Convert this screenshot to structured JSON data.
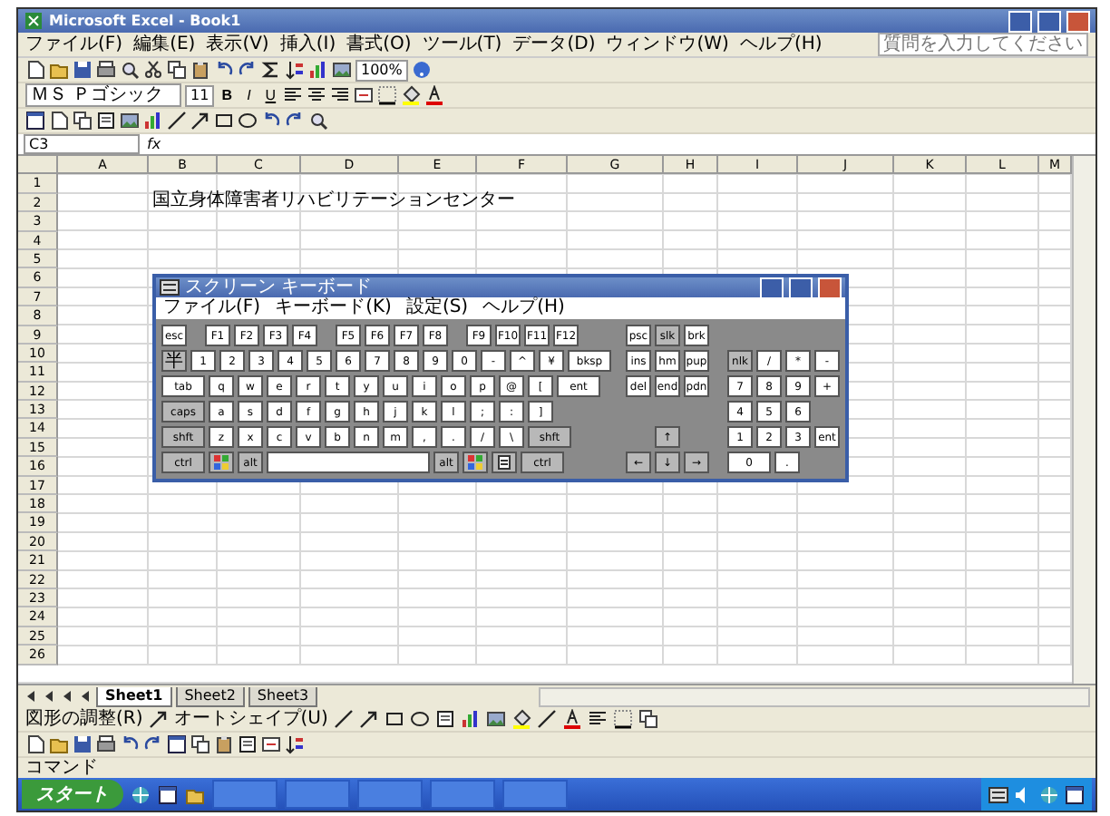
{
  "window": {
    "title": "Microsoft Excel - Book1"
  },
  "menu": {
    "items": [
      "ファイル(F)",
      "編集(E)",
      "表示(V)",
      "挿入(I)",
      "書式(O)",
      "ツール(T)",
      "データ(D)",
      "ウィンドウ(W)",
      "ヘルプ(H)"
    ],
    "help_placeholder": "質問を入力してください"
  },
  "standard_toolbar": {
    "zoom": "100%"
  },
  "formatting_toolbar": {
    "font": "ＭＳ Ｐゴシック",
    "size": "11",
    "bold": "B",
    "italic": "I",
    "underline": "U"
  },
  "formula_bar": {
    "name_box": "C3",
    "fx": "fx"
  },
  "sheet": {
    "columns": [
      "A",
      "B",
      "C",
      "D",
      "E",
      "F",
      "G",
      "H",
      "I",
      "J",
      "K",
      "L",
      "M"
    ],
    "rows": [
      {
        "header": "1"
      },
      {
        "header": "2",
        "cells": [
          null,
          "国立身体障害者リハビリテーションセンター"
        ]
      },
      {
        "header": "3"
      },
      {
        "header": "4"
      },
      {
        "header": "5"
      },
      {
        "header": "6"
      },
      {
        "header": "7"
      },
      {
        "header": "8"
      },
      {
        "header": "9"
      },
      {
        "header": "10"
      },
      {
        "header": "11"
      },
      {
        "header": "12"
      },
      {
        "header": "13"
      },
      {
        "header": "14"
      },
      {
        "header": "15"
      },
      {
        "header": "16"
      },
      {
        "header": "17"
      },
      {
        "header": "18"
      },
      {
        "header": "19"
      },
      {
        "header": "20"
      },
      {
        "header": "21"
      },
      {
        "header": "22"
      },
      {
        "header": "23"
      },
      {
        "header": "24"
      },
      {
        "header": "25"
      },
      {
        "header": "26"
      }
    ]
  },
  "sheet_tabs": [
    {
      "label": "Sheet1",
      "selected": true
    },
    {
      "label": "Sheet2",
      "selected": false
    },
    {
      "label": "Sheet3",
      "selected": false
    }
  ],
  "drawing_toolbar": {
    "adjust": "図形の調整(R)",
    "autoshape": "オートシェイプ(U)"
  },
  "status_bar": {
    "text": "コマンド"
  },
  "taskbar": {
    "start": "スタート"
  },
  "keyboard": {
    "title": "スクリーン キーボード",
    "menu": [
      "ファイル(F)",
      "キーボード(K)",
      "設定(S)",
      "ヘルプ(H)"
    ],
    "rows": [
      {
        "main": [
          {
            "label": "esc",
            "kind": "key"
          },
          {
            "label": "F1",
            "kind": "lead"
          },
          {
            "label": "F2",
            "kind": "key"
          },
          {
            "label": "F3",
            "kind": "key"
          },
          {
            "label": "F4",
            "kind": "key"
          },
          {
            "label": "F5",
            "kind": "lead"
          },
          {
            "label": "F6",
            "kind": "key"
          },
          {
            "label": "F7",
            "kind": "key"
          },
          {
            "label": "F8",
            "kind": "key"
          },
          {
            "label": "F9",
            "kind": "lead"
          },
          {
            "label": "F10",
            "kind": "key"
          },
          {
            "label": "F11",
            "kind": "key"
          },
          {
            "label": "F12",
            "kind": "key"
          }
        ],
        "nav": [
          {
            "label": "psc",
            "kind": "key"
          },
          {
            "label": "slk",
            "kind": "mod"
          },
          {
            "label": "brk",
            "kind": "key"
          }
        ]
      },
      {
        "main": [
          {
            "label": "半",
            "kind": "jp"
          },
          {
            "label": "1",
            "kind": "key"
          },
          {
            "label": "2",
            "kind": "key"
          },
          {
            "label": "3",
            "kind": "key"
          },
          {
            "label": "4",
            "kind": "key"
          },
          {
            "label": "5",
            "kind": "key"
          },
          {
            "label": "6",
            "kind": "key"
          },
          {
            "label": "7",
            "kind": "key"
          },
          {
            "label": "8",
            "kind": "key"
          },
          {
            "label": "9",
            "kind": "key"
          },
          {
            "label": "0",
            "kind": "key"
          },
          {
            "label": "-",
            "kind": "key"
          },
          {
            "label": "^",
            "kind": "key"
          },
          {
            "label": "¥",
            "kind": "key"
          },
          {
            "label": "bksp",
            "kind": "wide"
          }
        ],
        "nav": [
          {
            "label": "ins",
            "kind": "key"
          },
          {
            "label": "hm",
            "kind": "key"
          },
          {
            "label": "pup",
            "kind": "key"
          }
        ],
        "pad": [
          {
            "label": "nlk",
            "kind": "mod"
          },
          {
            "label": "/",
            "kind": "key"
          },
          {
            "label": "*",
            "kind": "key"
          },
          {
            "label": "-",
            "kind": "key"
          }
        ]
      },
      {
        "main": [
          {
            "label": "tab",
            "kind": "wide"
          },
          {
            "label": "q",
            "kind": "key"
          },
          {
            "label": "w",
            "kind": "key"
          },
          {
            "label": "e",
            "kind": "key"
          },
          {
            "label": "r",
            "kind": "key"
          },
          {
            "label": "t",
            "kind": "key"
          },
          {
            "label": "y",
            "kind": "key"
          },
          {
            "label": "u",
            "kind": "key"
          },
          {
            "label": "i",
            "kind": "key"
          },
          {
            "label": "o",
            "kind": "key"
          },
          {
            "label": "p",
            "kind": "key"
          },
          {
            "label": "@",
            "kind": "key"
          },
          {
            "label": "[",
            "kind": "key"
          },
          {
            "label": "ent",
            "kind": "wide"
          }
        ],
        "nav": [
          {
            "label": "del",
            "kind": "key"
          },
          {
            "label": "end",
            "kind": "key"
          },
          {
            "label": "pdn",
            "kind": "key"
          }
        ],
        "pad": [
          {
            "label": "7",
            "kind": "key"
          },
          {
            "label": "8",
            "kind": "key"
          },
          {
            "label": "9",
            "kind": "key"
          },
          {
            "label": "+",
            "kind": "key"
          }
        ]
      },
      {
        "main": [
          {
            "label": "caps",
            "kind": "widemod"
          },
          {
            "label": "a",
            "kind": "key"
          },
          {
            "label": "s",
            "kind": "key"
          },
          {
            "label": "d",
            "kind": "key"
          },
          {
            "label": "f",
            "kind": "key"
          },
          {
            "label": "g",
            "kind": "key"
          },
          {
            "label": "h",
            "kind": "key"
          },
          {
            "label": "j",
            "kind": "key"
          },
          {
            "label": "k",
            "kind": "key"
          },
          {
            "label": "l",
            "kind": "key"
          },
          {
            "label": ";",
            "kind": "key"
          },
          {
            "label": ":",
            "kind": "key"
          },
          {
            "label": "]",
            "kind": "key"
          }
        ],
        "pad": [
          {
            "label": "4",
            "kind": "key"
          },
          {
            "label": "5",
            "kind": "key"
          },
          {
            "label": "6",
            "kind": "key"
          }
        ]
      },
      {
        "main": [
          {
            "label": "shft",
            "kind": "widemod"
          },
          {
            "label": "z",
            "kind": "key"
          },
          {
            "label": "x",
            "kind": "key"
          },
          {
            "label": "c",
            "kind": "key"
          },
          {
            "label": "v",
            "kind": "key"
          },
          {
            "label": "b",
            "kind": "key"
          },
          {
            "label": "n",
            "kind": "key"
          },
          {
            "label": "m",
            "kind": "key"
          },
          {
            "label": ",",
            "kind": "key"
          },
          {
            "label": ".",
            "kind": "key"
          },
          {
            "label": "/",
            "kind": "key"
          },
          {
            "label": "\\",
            "kind": "key"
          },
          {
            "label": "shft",
            "kind": "widemod"
          }
        ],
        "nav": [
          {
            "label": "↑",
            "kind": "mid"
          }
        ],
        "pad": [
          {
            "label": "1",
            "kind": "key"
          },
          {
            "label": "2",
            "kind": "key"
          },
          {
            "label": "3",
            "kind": "key"
          },
          {
            "label": "ent",
            "kind": "key"
          }
        ]
      },
      {
        "main": [
          {
            "label": "ctrl",
            "kind": "widemod"
          },
          {
            "kind": "winkey"
          },
          {
            "label": "alt",
            "kind": "mod"
          },
          {
            "kind": "space"
          },
          {
            "label": "alt",
            "kind": "mod"
          },
          {
            "kind": "winkey"
          },
          {
            "kind": "menukey"
          },
          {
            "label": "ctrl",
            "kind": "widemod"
          }
        ],
        "nav": [
          {
            "label": "←",
            "kind": "mod"
          },
          {
            "label": "↓",
            "kind": "mod"
          },
          {
            "label": "→",
            "kind": "mod"
          }
        ],
        "pad": [
          {
            "label": "0",
            "kind": "wide"
          },
          {
            "label": ".",
            "kind": "key"
          }
        ]
      }
    ]
  }
}
